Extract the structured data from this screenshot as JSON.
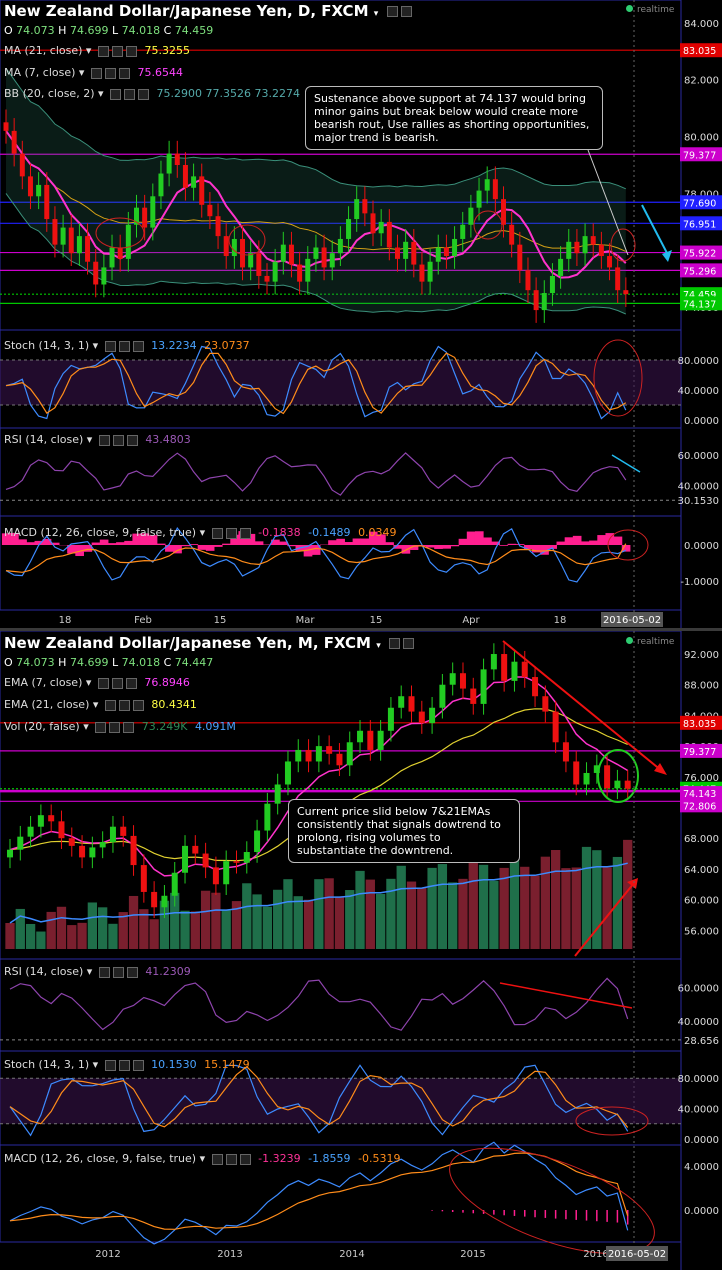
{
  "daily": {
    "title": "New Zealand Dollar/Japanese Yen, D, FXCM",
    "realtime_label": "realtime",
    "ohlc": {
      "o_label": "O",
      "o": "74.073",
      "h_label": "H",
      "h": "74.699",
      "l_label": "L",
      "l": "74.018",
      "c_label": "C",
      "c": "74.459"
    },
    "legends": {
      "ma21": {
        "label": "MA (21, close)",
        "value": "75.3255",
        "color": "#ffff44"
      },
      "ma7": {
        "label": "MA (7, close)",
        "value": "75.6544",
        "color": "#ff44ff"
      },
      "bb": {
        "label": "BB (20, close, 2)",
        "values": "75.2900  77.3526  73.2274",
        "color": "#5aa"
      },
      "stoch": {
        "label": "Stoch (14, 3, 1)",
        "k": "13.2234",
        "d": "23.0737"
      },
      "rsi": {
        "label": "RSI (14, close)",
        "value": "43.4803"
      },
      "macd": {
        "label": "MACD (12, 26, close, 9, false, true)",
        "hist": "-0.1838",
        "macd": "-0.1489",
        "signal": "0.0349"
      }
    },
    "annotation": "Sustenance above support at 74.137 would bring minor gains but break below would create more bearish rout, Use rallies as shorting opportunities, major trend is bearish.",
    "price_axis": [
      "84.000",
      "82.000",
      "80.000",
      "78.000",
      "74.000"
    ],
    "price_tags": [
      {
        "text": "83.035",
        "color": "#e00000"
      },
      {
        "text": "79.377",
        "color": "#cc00cc"
      },
      {
        "text": "77.690",
        "color": "#2020ff"
      },
      {
        "text": "76.951",
        "color": "#2020ff"
      },
      {
        "text": "75.922",
        "color": "#cc00cc"
      },
      {
        "text": "75.296",
        "color": "#cc00cc"
      },
      {
        "text": "74.459",
        "color": "#00c800"
      },
      {
        "text": "74.137",
        "color": "#00c800"
      }
    ],
    "stoch_axis": [
      "80.0000",
      "40.0000",
      "0.0000"
    ],
    "rsi_axis": [
      "60.0000",
      "40.0000",
      "30.1530"
    ],
    "macd_axis": [
      "0.0000",
      "-1.0000"
    ],
    "time_axis": [
      "18",
      "Feb",
      "15",
      "Mar",
      "15",
      "Apr",
      "18"
    ],
    "date_tag": "2016-05-02"
  },
  "monthly": {
    "title": "New Zealand Dollar/Japanese Yen, M, FXCM",
    "realtime_label": "realtime",
    "ohlc": {
      "o_label": "O",
      "o": "74.073",
      "h_label": "H",
      "h": "74.699",
      "l_label": "L",
      "l": "74.018",
      "c_label": "C",
      "c": "74.447"
    },
    "legends": {
      "ema7": {
        "label": "EMA (7, close)",
        "value": "76.8946",
        "color": "#ff44ff"
      },
      "ema21": {
        "label": "EMA (21, close)",
        "value": "80.4341",
        "color": "#ffff44"
      },
      "vol": {
        "label": "Vol (20, false)",
        "v1": "73.249K",
        "v2": "4.091M"
      },
      "rsi": {
        "label": "RSI (14, close)",
        "value": "41.2309"
      },
      "stoch": {
        "label": "Stoch (14, 3, 1)",
        "k": "10.1530",
        "d": "15.1479"
      },
      "macd": {
        "label": "MACD (12, 26, close, 9, false, true)",
        "hist": "-1.3239",
        "macd": "-1.8559",
        "signal": "-0.5319"
      }
    },
    "annotation": "Current price slid below 7&21EMAs consistently that signals dowtrend to prolong, rising volumes to substantiate the downtrend.",
    "price_axis": [
      "92.000",
      "88.000",
      "84.000",
      "80.000",
      "76.000",
      "68.000",
      "64.000",
      "60.000",
      "56.000"
    ],
    "price_tags": [
      {
        "text": "83.035",
        "color": "#e00000"
      },
      {
        "text": "79.377",
        "color": "#cc00cc"
      },
      {
        "text": "74.447",
        "color": "#00c800"
      },
      {
        "text": "74.143",
        "color": "#cc00cc"
      },
      {
        "text": "72.806",
        "color": "#cc00cc"
      }
    ],
    "rsi_axis": [
      "60.0000",
      "40.0000",
      "28.656"
    ],
    "stoch_axis": [
      "80.0000",
      "40.0000",
      "0.0000"
    ],
    "macd_axis": [
      "4.0000",
      "0.0000"
    ],
    "time_axis": [
      "2012",
      "2013",
      "2014",
      "2015",
      "2016"
    ],
    "date_tag": "2016-05-02"
  },
  "chart_data": [
    {
      "type": "candlestick",
      "title": "New Zealand Dollar/Japanese Yen, D, FXCM",
      "ylim": [
        73.2,
        84.8
      ],
      "x_ticks": [
        "18",
        "Feb",
        "15",
        "Mar",
        "15",
        "Apr",
        "18"
      ],
      "last_close": 74.459,
      "levels": [
        83.035,
        79.377,
        77.69,
        76.951,
        75.922,
        75.296,
        74.459,
        74.137
      ],
      "closes": [
        80.2,
        79.4,
        78.6,
        77.9,
        78.3,
        77.1,
        76.2,
        76.8,
        75.9,
        76.5,
        75.6,
        74.8,
        75.4,
        76.1,
        75.7,
        76.9,
        77.5,
        76.8,
        77.9,
        78.7,
        79.4,
        79.0,
        78.2,
        78.6,
        77.6,
        77.2,
        76.5,
        75.8,
        76.4,
        75.4,
        75.9,
        75.1,
        74.9,
        75.6,
        76.2,
        75.5,
        74.9,
        75.7,
        76.1,
        75.4,
        75.9,
        76.4,
        77.1,
        77.8,
        77.3,
        76.6,
        77.0,
        76.1,
        75.7,
        76.3,
        75.5,
        74.9,
        75.6,
        76.1,
        75.8,
        76.4,
        76.9,
        77.5,
        78.1,
        78.5,
        77.8,
        76.9,
        76.2,
        75.3,
        74.6,
        73.9,
        74.5,
        75.1,
        75.7,
        76.3,
        75.9,
        76.5,
        76.2,
        75.8,
        75.4,
        74.6,
        74.459
      ],
      "stoch_k_last": 13.2234,
      "stoch_d_last": 23.0737,
      "rsi_last": 43.4803,
      "macd_hist_last": -0.1838,
      "macd_last": -0.1489,
      "signal_last": 0.0349
    },
    {
      "type": "candlestick",
      "title": "New Zealand Dollar/Japanese Yen, M, FXCM",
      "ylim": [
        52,
        95
      ],
      "x_ticks": [
        "2012",
        "2013",
        "2014",
        "2015",
        "2016"
      ],
      "last_close": 74.447,
      "levels": [
        83.035,
        79.377,
        74.447,
        74.143,
        72.806
      ],
      "closes": [
        66.5,
        68.2,
        69.5,
        71.0,
        70.2,
        68.0,
        67.0,
        65.5,
        66.8,
        67.5,
        69.5,
        68.3,
        64.5,
        61.0,
        59.0,
        60.5,
        63.5,
        67.0,
        66.0,
        64.2,
        62.0,
        65.0,
        64.8,
        66.2,
        69.0,
        72.5,
        75.0,
        78.0,
        79.5,
        78.0,
        80.0,
        79.0,
        77.5,
        80.5,
        82.0,
        79.5,
        82.0,
        85.0,
        86.5,
        84.5,
        83.0,
        85.0,
        88.0,
        89.5,
        87.5,
        85.5,
        90.0,
        92.0,
        88.5,
        91.0,
        89.0,
        86.5,
        84.5,
        80.5,
        78.0,
        75.0,
        76.5,
        77.5,
        74.5,
        75.5,
        74.447
      ],
      "rsi_last": 41.2309,
      "stoch_k_last": 10.153,
      "stoch_d_last": 15.1479,
      "macd_hist_last": -1.3239,
      "macd_last": -1.8559,
      "signal_last": -0.5319,
      "volume_trend": "rising"
    }
  ]
}
